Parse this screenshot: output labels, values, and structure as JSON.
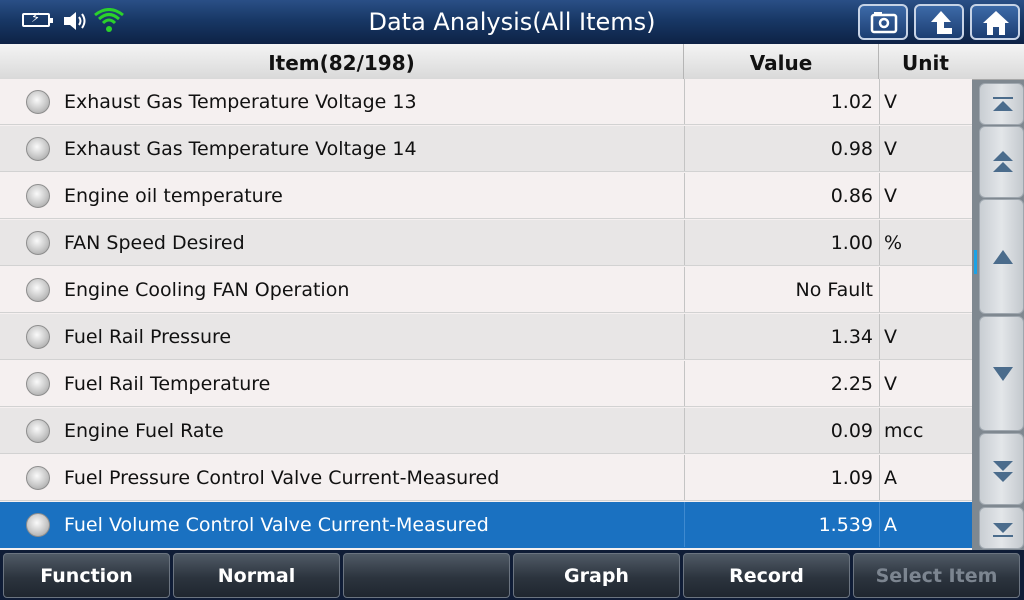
{
  "header": {
    "title": "Data Analysis(All Items)",
    "icons": [
      "battery-charging-icon",
      "speaker-icon",
      "wifi-icon",
      "print-screen-icon",
      "back-arrow-icon",
      "home-icon"
    ]
  },
  "table": {
    "columns": {
      "item": "Item(82/198)",
      "value": "Value",
      "unit": "Unit"
    },
    "rows": [
      {
        "item": "Exhaust Gas Temperature Voltage 13",
        "value": "1.02",
        "unit": "V"
      },
      {
        "item": "Exhaust Gas Temperature Voltage 14",
        "value": "0.98",
        "unit": "V"
      },
      {
        "item": "Engine oil temperature",
        "value": "0.86",
        "unit": "V"
      },
      {
        "item": "FAN Speed Desired",
        "value": "1.00",
        "unit": "%"
      },
      {
        "item": "Engine Cooling FAN Operation",
        "value": "No Fault",
        "unit": ""
      },
      {
        "item": "Fuel Rail Pressure",
        "value": "1.34",
        "unit": "V"
      },
      {
        "item": "Fuel Rail Temperature",
        "value": "2.25",
        "unit": "V"
      },
      {
        "item": "Engine Fuel Rate",
        "value": "0.09",
        "unit": "mcc"
      },
      {
        "item": "Fuel Pressure Control Valve Current-Measured",
        "value": "1.09",
        "unit": "A"
      },
      {
        "item": "Fuel Volume Control Valve Current-Measured",
        "value": "1.539",
        "unit": "A"
      }
    ],
    "selected_row": 9
  },
  "scroll": {
    "buttons": [
      "scroll-top-icon",
      "page-up-icon",
      "line-up-icon",
      "line-down-icon",
      "page-down-icon",
      "scroll-bottom-icon"
    ]
  },
  "footer": {
    "buttons": [
      "Function",
      "Normal",
      "",
      "Graph",
      "Record",
      "Select Item"
    ]
  },
  "colors": {
    "topbar": "#183866",
    "selected_row": "#1a71c1",
    "wifi": "#2bd12b",
    "scroll_indicator": "#1aa2e6"
  }
}
